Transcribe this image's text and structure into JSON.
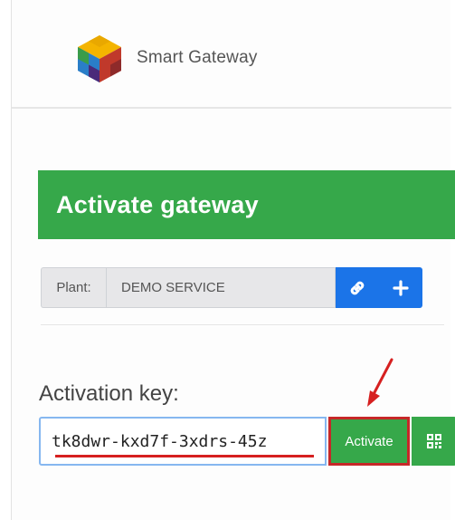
{
  "header": {
    "app_title": "Smart Gateway",
    "logo_icon": "cube-logo-icon"
  },
  "panel": {
    "heading": "Activate gateway",
    "heading_color": "#36a84a"
  },
  "plant": {
    "label": "Plant:",
    "value": "DEMO SERVICE",
    "link_icon": "link-icon",
    "add_icon": "plus-icon",
    "button_color": "#1b74e8"
  },
  "activation": {
    "label": "Activation key:",
    "key_value": "tk8dwr-kxd7f-3xdrs-45z",
    "activate_label": "Activate",
    "qr_icon": "qr-code-icon"
  },
  "annotation": {
    "arrow_color": "#d62020",
    "highlight_color": "#c62828"
  }
}
